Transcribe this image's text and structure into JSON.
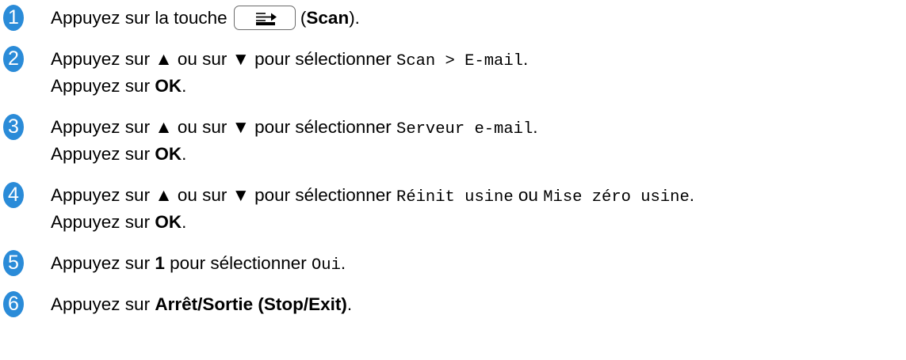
{
  "colors": {
    "badge_fill": "#2a8bd8",
    "text": "#000000"
  },
  "steps": [
    {
      "number": "1",
      "before_key": "Appuyez sur la touche",
      "key_icon": "scan-key-icon",
      "after_key_open": "(",
      "key_name": "Scan",
      "after_key_close": ")."
    },
    {
      "number": "2",
      "line1_text": "Appuyez sur ▲ ou sur ▼ pour sélectionner",
      "line1_code": "Scan > E-mail",
      "line1_end": ".",
      "line2_text": "Appuyez sur",
      "line2_bold": "OK",
      "line2_end": "."
    },
    {
      "number": "3",
      "line1_text": "Appuyez sur ▲ ou sur ▼ pour sélectionner",
      "line1_code": "Serveur e-mail",
      "line1_end": ".",
      "line2_text": "Appuyez sur",
      "line2_bold": "OK",
      "line2_end": "."
    },
    {
      "number": "4",
      "line1_text": "Appuyez sur ▲ ou sur ▼ pour sélectionner",
      "line1_code": "Réinit usine",
      "line1_mid": "ou",
      "line1_code2": "Mise zéro usine",
      "line1_end": ".",
      "line2_text": "Appuyez sur",
      "line2_bold": "OK",
      "line2_end": "."
    },
    {
      "number": "5",
      "text": "Appuyez sur",
      "bold": "1",
      "text2": "pour sélectionner",
      "code": "Oui",
      "end": "."
    },
    {
      "number": "6",
      "text": "Appuyez sur",
      "bold": "Arrêt/Sortie (Stop/Exit)",
      "end": "."
    }
  ]
}
